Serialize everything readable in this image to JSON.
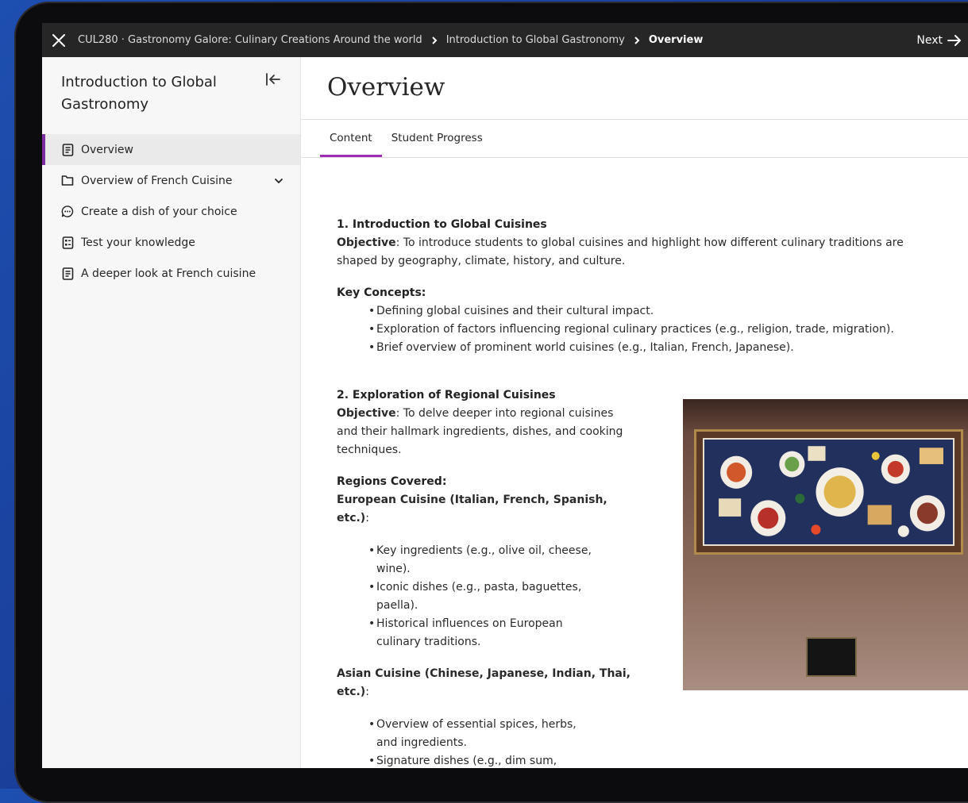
{
  "topbar": {
    "breadcrumb_course": "CUL280 · Gastronomy Galore: Culinary Creations Around the world",
    "breadcrumb_module": "Introduction to Global Gastronomy",
    "breadcrumb_current": "Overview",
    "next_label": "Next"
  },
  "sidebar": {
    "title": "Introduction to Global Gastronomy",
    "items": [
      {
        "label": "Overview",
        "icon": "document-icon"
      },
      {
        "label": "Overview of French Cuisine",
        "icon": "folder-icon"
      },
      {
        "label": "Create a dish of your choice",
        "icon": "chat-icon"
      },
      {
        "label": "Test your knowledge",
        "icon": "test-icon"
      },
      {
        "label": "A deeper look at French cuisine",
        "icon": "document-icon"
      }
    ]
  },
  "main": {
    "title": "Overview",
    "tabs": [
      {
        "label": "Content"
      },
      {
        "label": "Student Progress"
      }
    ],
    "section1": {
      "heading": "1. Introduction to Global Cuisines",
      "objective_label": "Objective",
      "objective_text": ": To introduce students to global cuisines and highlight how different culinary traditions are shaped by geography, climate, history, and culture.",
      "key_concepts_label": "Key Concepts:",
      "key_concepts": [
        "Defining global cuisines and their cultural impact.",
        "Exploration of factors influencing regional culinary practices (e.g., religion, trade, migration).",
        "Brief overview of prominent world cuisines (e.g., Italian, French, Japanese)."
      ]
    },
    "section2": {
      "heading": "2. Exploration of Regional Cuisines",
      "objective_label": "Objective",
      "objective_text": ": To delve deeper into regional cuisines and their hallmark ingredients, dishes, and cooking techniques.",
      "regions_label": "Regions Covered:",
      "european_label": "European Cuisine (Italian, French, Spanish, etc.)",
      "european_items": [
        "Key ingredients (e.g., olive oil, cheese, wine).",
        "Iconic dishes (e.g., pasta, baguettes, paella).",
        "Historical influences on European culinary traditions."
      ],
      "asian_label": "Asian Cuisine (Chinese, Japanese, Indian, Thai, etc.)",
      "asian_items": [
        "Overview of essential spices, herbs, and ingredients.",
        "Signature dishes (e.g., dim sum,"
      ]
    }
  }
}
